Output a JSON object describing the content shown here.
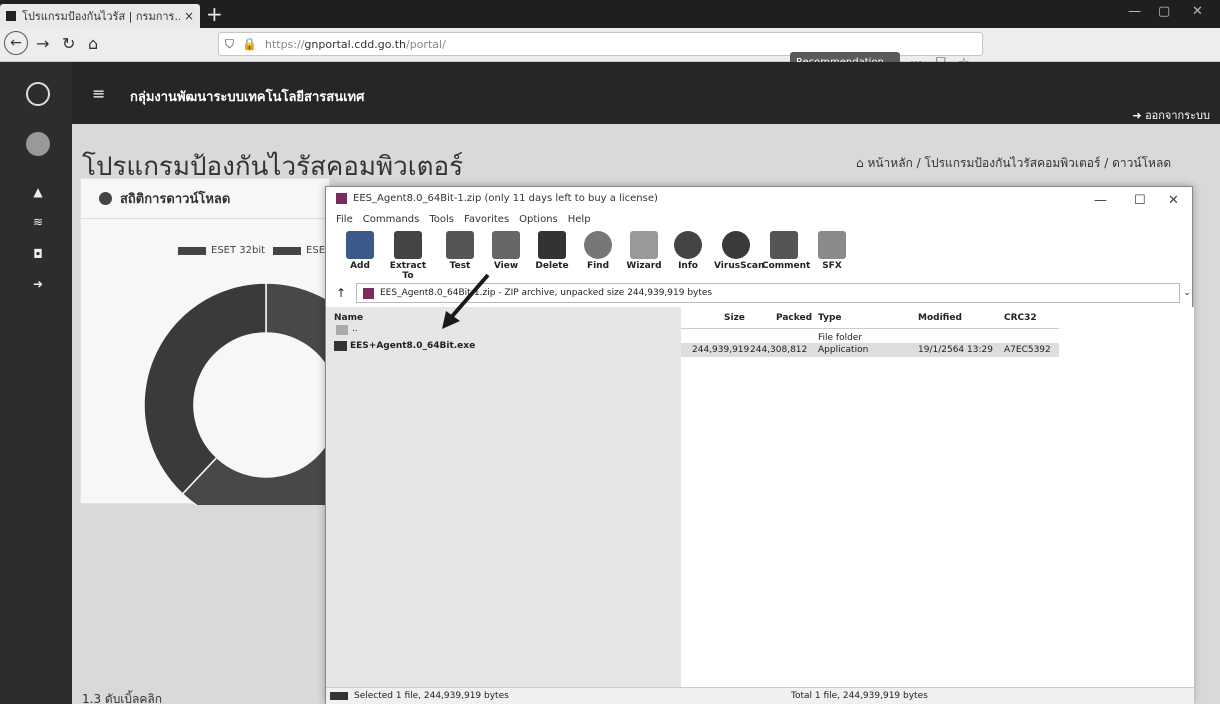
{
  "browser": {
    "tab_title": "โปรแกรมป้องกันไวรัส | กรมการ...",
    "tab_close": "×",
    "new_tab": "+",
    "url_prefix": "https://",
    "url_domain": "gnportal.cdd.go.th",
    "url_path": "/portal/",
    "recommendation": "Recommendation",
    "more": "···"
  },
  "sidebar": {
    "icons": [
      "home-icon",
      "database-icon",
      "shield-icon",
      "sign-out-icon"
    ]
  },
  "pagebar": {
    "title": "กลุ่มงานพัฒนาระบบเทคโนโลยีสารสนเทศ",
    "logout": "ออกจากระบบ"
  },
  "page": {
    "heading": "โปรแกรมป้องกันไวรัสคอมพิวเตอร์",
    "breadcrumb": {
      "home": "หน้าหลัก",
      "sep1": "/",
      "item": "โปรแกรมป้องกันไวรัสคอมพิวเตอร์",
      "sep2": "/",
      "current": "ดาวน์โหลด"
    },
    "footer_text": "1.3 ดับเบิ้ลคลิก"
  },
  "stats_card": {
    "title": "สถิติการดาวน์โหลด",
    "legend": [
      "ESET 32bit",
      "ESE"
    ]
  },
  "chart_data": {
    "type": "pie",
    "title": "",
    "series": [
      {
        "name": "ESET 32bit",
        "values": [
          62
        ]
      },
      {
        "name": "ESE",
        "values": [
          38
        ]
      }
    ],
    "colors": [
      "#484848",
      "#3a3a3a"
    ]
  },
  "winrar": {
    "title": "EES_Agent8.0_64Bit-1.zip (only 11 days left to buy a license)",
    "menu": [
      "File",
      "Commands",
      "Tools",
      "Favorites",
      "Options",
      "Help"
    ],
    "toolbar": [
      "Add",
      "Extract To",
      "Test",
      "View",
      "Delete",
      "Find",
      "Wizard",
      "Info",
      "VirusScan",
      "Comment",
      "SFX"
    ],
    "path": "EES_Agent8.0_64Bit-1.zip - ZIP archive, unpacked size 244,939,919 bytes",
    "columns": [
      "Name",
      "Size",
      "Packed",
      "Type",
      "Modified",
      "CRC32"
    ],
    "rows": [
      {
        "name": "..",
        "size": "",
        "packed": "",
        "type": "File folder",
        "modified": "",
        "crc": ""
      },
      {
        "name": "EES+Agent8.0_64Bit.exe",
        "size": "244,939,919",
        "packed": "244,308,812",
        "type": "Application",
        "modified": "19/1/2564 13:29",
        "crc": "A7EC5392"
      }
    ],
    "status_left": "Selected 1 file, 244,939,919 bytes",
    "status_right": "Total 1 file, 244,939,919 bytes"
  }
}
